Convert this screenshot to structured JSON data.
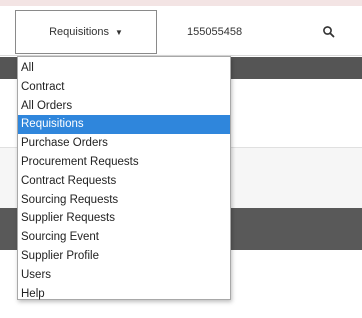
{
  "search": {
    "scope_label": "Requisitions",
    "query_value": "155055458",
    "icon": "search-icon"
  },
  "dropdown": {
    "selected": "Requisitions",
    "options": [
      "All",
      "Contract",
      "All Orders",
      "Requisitions",
      "Purchase Orders",
      "Procurement Requests",
      "Contract Requests",
      "Sourcing Requests",
      "Supplier Requests",
      "Sourcing Event",
      "Supplier Profile",
      "Users",
      "Help"
    ]
  },
  "colors": {
    "selected_bg": "#2f86dc",
    "header_band": "#555555"
  }
}
